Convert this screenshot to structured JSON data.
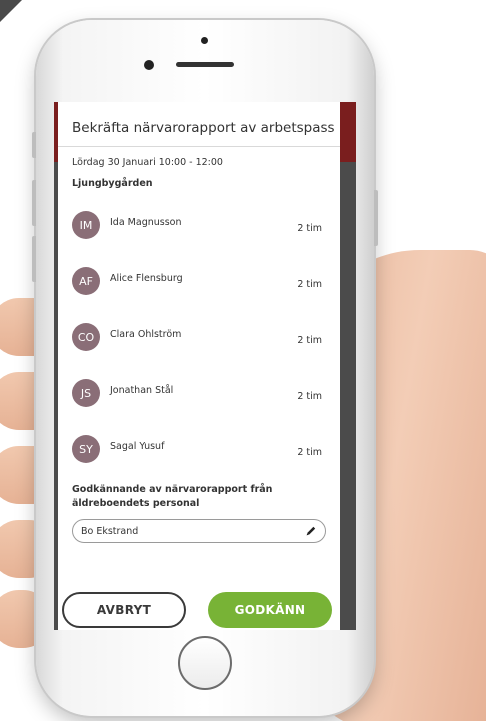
{
  "dialog": {
    "title": "Bekräfta närvarorapport av arbetspass",
    "date_time": "Lördag 30 Januari 10:00 - 12:00",
    "location": "Ljungbygården"
  },
  "people": [
    {
      "initials": "IM",
      "name": "Ida Magnusson",
      "hours": "2 tim"
    },
    {
      "initials": "AF",
      "name": "Alice Flensburg",
      "hours": "2 tim"
    },
    {
      "initials": "CO",
      "name": "Clara Ohlström",
      "hours": "2 tim"
    },
    {
      "initials": "JS",
      "name": "Jonathan Stål",
      "hours": "2 tim"
    },
    {
      "initials": "SY",
      "name": "Sagal Yusuf",
      "hours": "2 tim"
    }
  ],
  "approval": {
    "label": "Godkännande av närvarorapport från äldreboendets personal",
    "value": "Bo Ekstrand",
    "icon": "pencil-icon"
  },
  "actions": {
    "cancel_label": "AVBRYT",
    "approve_label": "GODKÄNN"
  },
  "colors": {
    "avatar": "#8a6e77",
    "approve": "#78b336",
    "header": "#7a1e1e"
  }
}
